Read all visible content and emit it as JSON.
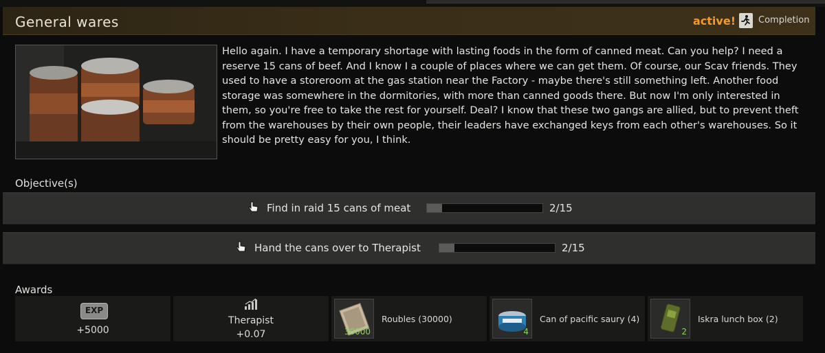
{
  "quest": {
    "title": "General wares",
    "status": "active!",
    "completion_label": "Completion",
    "description": "Hello again. I have a temporary shortage with lasting foods in the form of canned meat. Can you help? I need a reserve 15 cans of beef. And I know I a couple of places where we can get them. Of course, our Scav friends. They used to have a storeroom at the gas station near the Factory - maybe there's still something left. Another food storage was somewhere in the dormitories, with more than canned goods there. But now I'm only interested in them, so you're free to take the rest for yourself. Deal? I know that these two gangs are allied, but to prevent theft from the warehouses by their own people, their leaders have exchanged keys from each other's warehouses. So it should be pretty easy for you, I think."
  },
  "objectives": {
    "label": "Objective(s)",
    "items": [
      {
        "text": "Find in raid 15 cans of meat",
        "progress": "2/15",
        "fraction": 0.1333
      },
      {
        "text": "Hand the cans over to Therapist",
        "progress": "2/15",
        "fraction": 0.1333
      }
    ]
  },
  "awards": {
    "label": "Awards",
    "exp_badge": "EXP",
    "exp_value": "+5000",
    "trader_name": "Therapist",
    "trader_value": "+0.07",
    "items": [
      {
        "name": "Roubles (30000)",
        "qty": "30000",
        "icon": "roubles-icon"
      },
      {
        "name": "Can of pacific saury (4)",
        "qty": "4",
        "icon": "can-icon"
      },
      {
        "name": "Iskra lunch box (2)",
        "qty": "2",
        "icon": "lunch-box-icon"
      }
    ]
  },
  "colors": {
    "accent": "#f49a2a",
    "header_bg": "#3a2e17",
    "row_bg": "#2f302e",
    "quantity_text": "#8fd162"
  }
}
